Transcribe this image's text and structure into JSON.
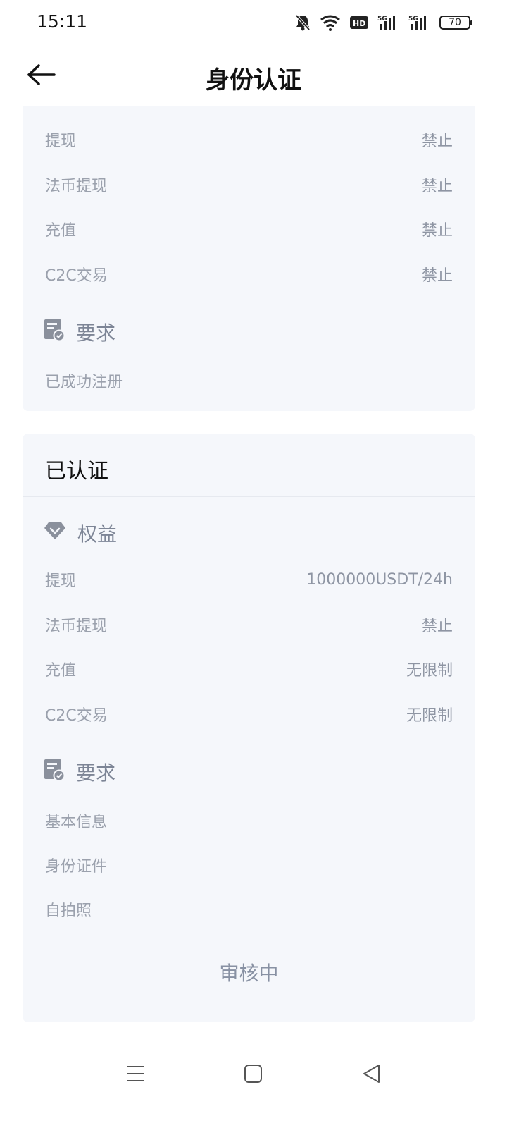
{
  "status_bar": {
    "time": "15:11",
    "icons": [
      "mute-bell-icon",
      "wifi-icon",
      "hd-icon",
      "signal-5g-icon",
      "signal-5g-icon"
    ],
    "battery": "70"
  },
  "header": {
    "title": "身份认证",
    "back_icon": "arrow-left-icon"
  },
  "top_card": {
    "rows": [
      {
        "label": "提现",
        "value": "禁止"
      },
      {
        "label": "法币提现",
        "value": "禁止"
      },
      {
        "label": "充值",
        "value": "禁止"
      },
      {
        "label": "C2C交易",
        "value": "禁止"
      }
    ],
    "requirements_title": "要求",
    "requirements": [
      "已成功注册"
    ]
  },
  "verified_card": {
    "title": "已认证",
    "benefits_title": "权益",
    "rows": [
      {
        "label": "提现",
        "value": "1000000USDT/24h"
      },
      {
        "label": "法币提现",
        "value": "禁止"
      },
      {
        "label": "充值",
        "value": "无限制"
      },
      {
        "label": "C2C交易",
        "value": "无限制"
      }
    ],
    "requirements_title": "要求",
    "requirements": [
      "基本信息",
      "身份证件",
      "自拍照"
    ],
    "status": "审核中"
  },
  "colors": {
    "card_bg": "#f5f7fb",
    "muted_text": "#9ba1ad",
    "icon_gray": "#8a909c"
  }
}
